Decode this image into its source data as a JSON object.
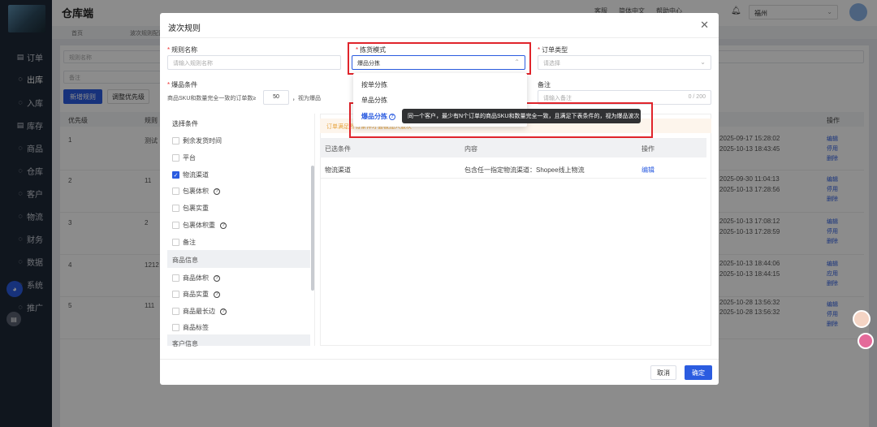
{
  "app": {
    "title": "仓库端"
  },
  "topbar": {
    "links": [
      "客服",
      "简体中文",
      "帮助中心"
    ],
    "city": "福州"
  },
  "tabs": [
    "首页",
    "波次规则配置"
  ],
  "sidebar": {
    "items": [
      {
        "label": "订单",
        "icon": "▤"
      },
      {
        "label": "出库",
        "icon": "◌"
      },
      {
        "label": "入库",
        "icon": "◌"
      },
      {
        "label": "库存",
        "icon": "▤"
      },
      {
        "label": "商品",
        "icon": "◌"
      },
      {
        "label": "仓库",
        "icon": "◌"
      },
      {
        "label": "客户",
        "icon": "◌"
      },
      {
        "label": "物流",
        "icon": "◌"
      },
      {
        "label": "财务",
        "icon": "◌"
      },
      {
        "label": "数据",
        "icon": "◌"
      },
      {
        "label": "系统",
        "icon": "◌"
      },
      {
        "label": "推广",
        "icon": "◌"
      }
    ]
  },
  "page": {
    "filters": {
      "rule_name_placeholder": "规则名称",
      "remark_placeholder": "备注"
    },
    "buttons": {
      "new_rule": "新增规则",
      "adjust_priority": "调整优先级"
    },
    "table": {
      "headers": [
        "优先级",
        "规则",
        "操作"
      ],
      "rows": [
        {
          "priority": "1",
          "name": "测试",
          "time1": "2025-09-17 15:28:02",
          "time2": "2025-10-13 18:43:45",
          "ops": [
            "编辑",
            "停用",
            "删除"
          ]
        },
        {
          "priority": "2",
          "name": "11",
          "time1": "2025-09-30 11:04:13",
          "time2": "2025-10-13 17:28:56",
          "ops": [
            "编辑",
            "停用",
            "删除"
          ]
        },
        {
          "priority": "3",
          "name": "2",
          "time1": "2025-10-13 17:08:12",
          "time2": "2025-10-13 17:28:59",
          "ops": [
            "编辑",
            "停用",
            "删除"
          ]
        },
        {
          "priority": "4",
          "name": "1212",
          "time1": "2025-10-13 18:44:06",
          "time2": "2025-10-13 18:44:15",
          "ops": [
            "编辑",
            "应用",
            "删除"
          ]
        },
        {
          "priority": "5",
          "name": "111",
          "time1": "2025-10-28 13:56:32",
          "time2": "2025-10-28 13:56:32",
          "ops": [
            "编辑",
            "停用",
            "删除"
          ]
        }
      ]
    }
  },
  "modal": {
    "title": "波次规则",
    "fields": {
      "rule_name": {
        "label": "规则名称",
        "placeholder": "请输入规则名称"
      },
      "pick_mode": {
        "label": "拣货模式",
        "value": "爆品分拣"
      },
      "order_type": {
        "label": "订单类型",
        "placeholder": "请选择"
      },
      "hot_condition": {
        "label": "爆品条件",
        "text_before": "商品SKU和数量完全一致的订单数≥",
        "value": "50",
        "text_after": "，视为爆品"
      },
      "remark": {
        "label": "备注",
        "placeholder": "请输入备注",
        "counter": "0 / 200"
      }
    },
    "dropdown": {
      "options": [
        "按单分拣",
        "单品分拣",
        "爆品分拣"
      ],
      "selected": "爆品分拣"
    },
    "tooltip": "同一个客户，最少有N个订单的商品SKU和数量完全一致，且满足下表条件的，视为爆品波次",
    "conditions": {
      "header": "选择条件",
      "items": [
        {
          "label": "剩余发货时间",
          "checked": false,
          "help": false
        },
        {
          "label": "平台",
          "checked": false,
          "help": false
        },
        {
          "label": "物流渠道",
          "checked": true,
          "help": false
        },
        {
          "label": "包裹体积",
          "checked": false,
          "help": true
        },
        {
          "label": "包裹实重",
          "checked": false,
          "help": false
        },
        {
          "label": "包裹体积重",
          "checked": false,
          "help": true
        },
        {
          "label": "备注",
          "checked": false,
          "help": false
        }
      ],
      "group_product": "商品信息",
      "product_items": [
        {
          "label": "商品体积",
          "checked": false,
          "help": true
        },
        {
          "label": "商品实重",
          "checked": false,
          "help": true
        },
        {
          "label": "商品最长边",
          "checked": false,
          "help": true
        },
        {
          "label": "商品标签",
          "checked": false,
          "help": false
        }
      ],
      "group_customer": "客户信息"
    },
    "warning": "订单满足所有条件才会被加入波次",
    "selected_table": {
      "headers": [
        "已选条件",
        "内容",
        "操作"
      ],
      "rows": [
        {
          "condition": "物流渠道",
          "content": "包含任一指定物流渠道：Shopee线上物流",
          "op": "编辑"
        }
      ]
    },
    "footer": {
      "cancel": "取消",
      "ok": "确定"
    }
  },
  "colors": {
    "primary": "#2b5ce0",
    "sidebar": "#1e2838",
    "highlight": "#e0242b",
    "warning": "#e6a23c"
  }
}
